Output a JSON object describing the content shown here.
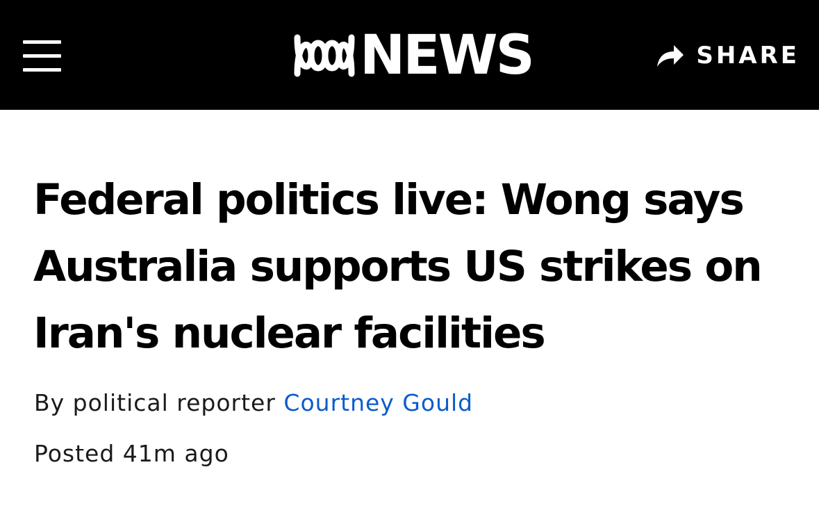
{
  "header": {
    "menu_icon": "hamburger-menu-icon",
    "logo_text": "NEWS",
    "logo_icon": "abc-lissajous-logo",
    "share_label": "SHARE",
    "share_icon": "share-arrow-icon",
    "background_color": "#000000"
  },
  "article": {
    "headline": "Federal politics live: Wong says Australia supports US strikes on Iran's nuclear facilities",
    "byline_prefix": "By political reporter ",
    "author": "Courtney Gould",
    "author_link_color": "#0a5ccc",
    "posted": "Posted 41m ago"
  }
}
